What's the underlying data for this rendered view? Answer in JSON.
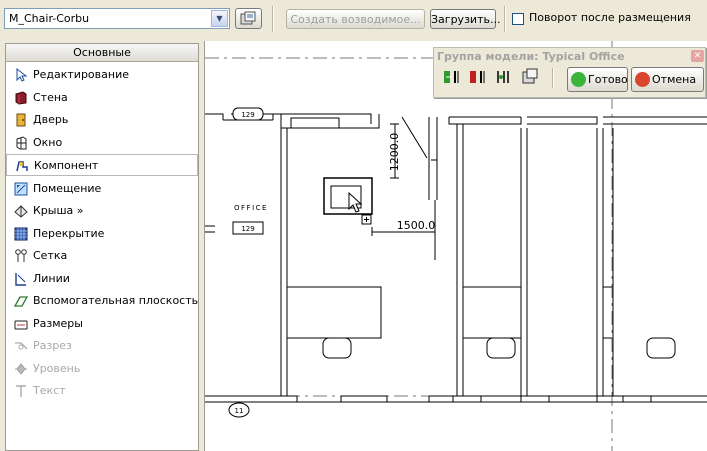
{
  "toolbar": {
    "family_selected": "M_Chair-Corbu",
    "create_similar_label": "Создать возводимое...",
    "load_label": "Загрузить...",
    "rotate_after_placement_label": "Поворот после размещения",
    "rotate_after_placement_checked": false
  },
  "design_bar": {
    "header": "Основные",
    "items": [
      {
        "label": "Редактирование",
        "icon": "cursor-arrow-icon",
        "selected": false,
        "disabled": false
      },
      {
        "label": "Стена",
        "icon": "wall-icon",
        "selected": false,
        "disabled": false
      },
      {
        "label": "Дверь",
        "icon": "door-icon",
        "selected": false,
        "disabled": false
      },
      {
        "label": "Окно",
        "icon": "window-icon",
        "selected": false,
        "disabled": false
      },
      {
        "label": "Компонент",
        "icon": "component-icon",
        "selected": true,
        "disabled": false
      },
      {
        "label": "Помещение",
        "icon": "room-icon",
        "selected": false,
        "disabled": false
      },
      {
        "label": "Крыша »",
        "icon": "roof-icon",
        "selected": false,
        "disabled": false
      },
      {
        "label": "Перекрытие",
        "icon": "floor-icon",
        "selected": false,
        "disabled": false
      },
      {
        "label": "Сетка",
        "icon": "grid-icon",
        "selected": false,
        "disabled": false
      },
      {
        "label": "Линии",
        "icon": "lines-icon",
        "selected": false,
        "disabled": false
      },
      {
        "label": "Вспомогательная плоскость",
        "icon": "ref-plane-icon",
        "selected": false,
        "disabled": false
      },
      {
        "label": "Размеры",
        "icon": "dimension-icon",
        "selected": false,
        "disabled": false
      },
      {
        "label": "Разрез",
        "icon": "section-icon",
        "selected": false,
        "disabled": true
      },
      {
        "label": "Уровень",
        "icon": "level-icon",
        "selected": false,
        "disabled": true
      },
      {
        "label": "Текст",
        "icon": "text-icon",
        "selected": false,
        "disabled": true
      }
    ]
  },
  "group_panel": {
    "title": "Группа модели: Typical Office",
    "finish_label": "Готово",
    "cancel_label": "Отмена"
  },
  "drawing": {
    "room_tag_top": "129",
    "room_name": "OFFICE",
    "room_number": "129",
    "grid_bubble": "11",
    "dim_vertical": "1200.0",
    "dim_horizontal": "1500.0"
  },
  "colors": {
    "wall": "#000000",
    "grid_line": "#7a7a7a",
    "background": "#ece9d8"
  }
}
